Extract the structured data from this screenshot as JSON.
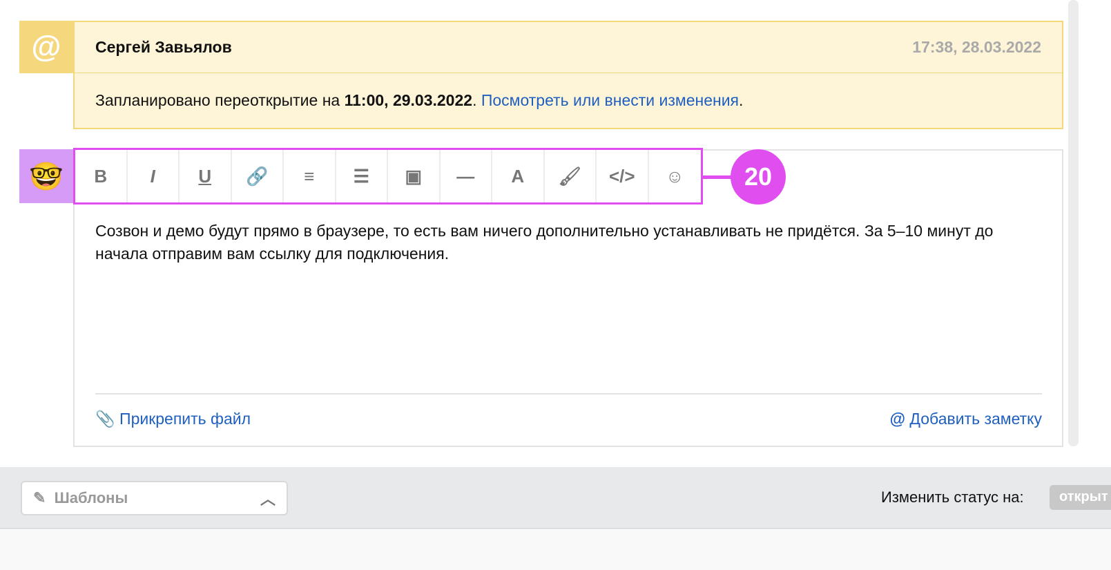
{
  "note": {
    "icon": "@",
    "author": "Сергей Завьялов",
    "time": "17:38, 28.03.2022",
    "text_prefix": "Запланировано переоткрытие на ",
    "text_bold": "11:00, 29.03.2022",
    "text_sep": ". ",
    "link": "Посмотреть или внести изменения",
    "text_end": "."
  },
  "editor": {
    "toolbar": [
      {
        "name": "bold",
        "glyph": "B"
      },
      {
        "name": "italic",
        "glyph": "I"
      },
      {
        "name": "underline",
        "glyph": "U"
      },
      {
        "name": "link",
        "glyph": "🔗"
      },
      {
        "name": "ordered-list",
        "glyph": "≡"
      },
      {
        "name": "bullet-list",
        "glyph": "☰"
      },
      {
        "name": "image",
        "glyph": "▣"
      },
      {
        "name": "horizontal-rule",
        "glyph": "—"
      },
      {
        "name": "font",
        "glyph": "A"
      },
      {
        "name": "paint-roller",
        "glyph": "🖌"
      },
      {
        "name": "code",
        "glyph": "</>"
      },
      {
        "name": "emoji",
        "glyph": "☺"
      }
    ],
    "badge": "20",
    "message": "Созвон и демо будут прямо в браузере, то есть вам ничего дополнительно устанавливать не придётся. За 5–10 минут до начала отправим вам ссылку для подключения.",
    "attach": "Прикрепить файл",
    "add_note": "Добавить заметку"
  },
  "bottom": {
    "templates": "Шаблоны",
    "status_label": "Изменить статус на:",
    "status_button": "открыт"
  },
  "colors": {
    "accent": "#e04ef0",
    "note_bg": "#fef5d8",
    "link": "#1f5fbf"
  }
}
